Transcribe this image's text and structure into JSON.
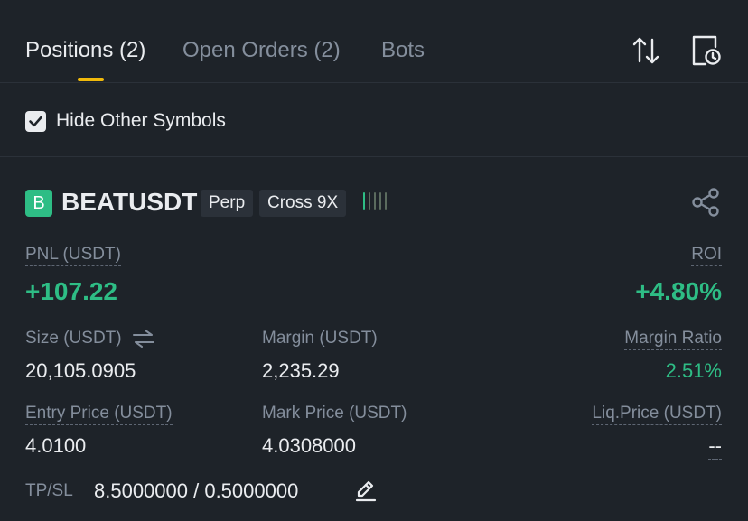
{
  "tabs": [
    {
      "label": "Positions (2)",
      "active": true
    },
    {
      "label": "Open Orders (2)",
      "active": false
    },
    {
      "label": "Bots",
      "active": false
    }
  ],
  "filter": {
    "label": "Hide Other Symbols",
    "checked": true
  },
  "position": {
    "badge": "B",
    "symbol": "BEATUSDT",
    "type_tag": "Perp",
    "margin_tag": "Cross 9X",
    "pnl_label": "PNL (USDT)",
    "pnl_value": "+107.22",
    "roi_label": "ROI",
    "roi_value": "+4.80%",
    "size_label": "Size (USDT)",
    "size_value": "20,105.0905",
    "margin_label": "Margin (USDT)",
    "margin_value": "2,235.29",
    "margin_ratio_label": "Margin Ratio",
    "margin_ratio_value": "2.51%",
    "entry_label": "Entry Price (USDT)",
    "entry_value": "4.0100",
    "mark_label": "Mark Price (USDT)",
    "mark_value": "4.0308000",
    "liq_label": "Liq.Price (USDT)",
    "liq_value": "--",
    "tpsl_label": "TP/SL",
    "tpsl_value": "8.5000000 / 0.5000000"
  },
  "colors": {
    "profit": "#2ebd85",
    "accent": "#f0b90b",
    "background": "#1e2329"
  },
  "icons": {
    "sort": "sort-arrows-icon",
    "history": "history-icon",
    "share": "share-icon",
    "swap": "swap-icon",
    "edit": "edit-icon",
    "check": "check-icon"
  }
}
